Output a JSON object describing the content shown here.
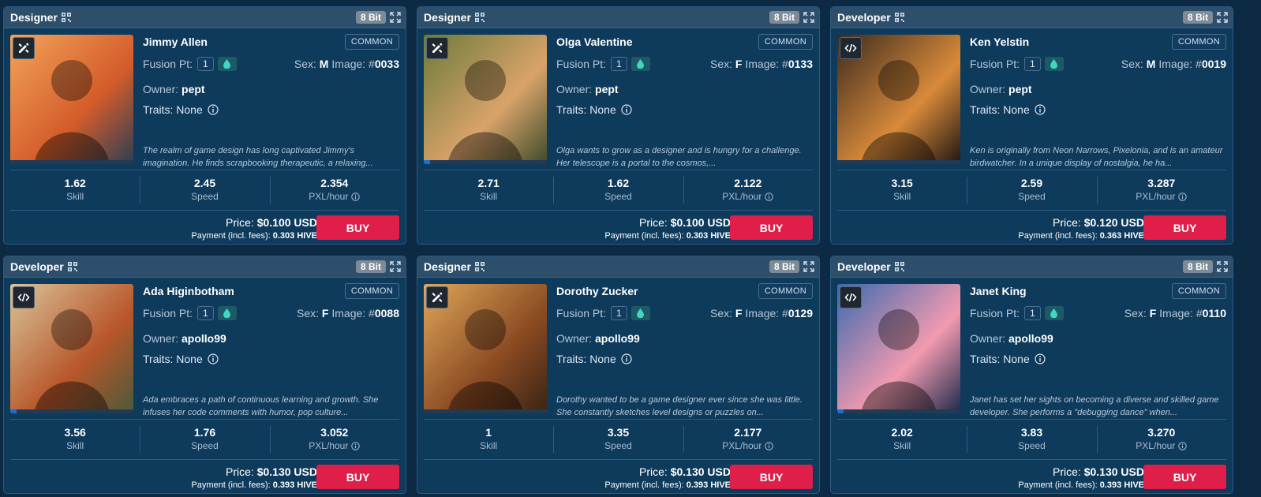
{
  "common_labels": {
    "fusion_label": "Fusion Pt:",
    "sex_label": "Sex:",
    "image_label": "Image: #",
    "owner_label": "Owner:",
    "traits_label": "Traits: None",
    "skill_label": "Skill",
    "speed_label": "Speed",
    "pxl_label": "PXL/hour",
    "price_label": "Price:",
    "payment_label": "Payment (incl. fees):",
    "buy_label": "BUY",
    "bit_label": "8 Bit",
    "rarity": "COMMON"
  },
  "cards": [
    {
      "role": "Designer",
      "role_icon": "design-tools-icon",
      "name": "Jimmy Allen",
      "fusion": "1",
      "sex": "M",
      "image": "0033",
      "owner": "pept",
      "desc": "The realm of game design has long captivated Jimmy's imagination. He finds scrapbooking therapeutic, a relaxing...",
      "skill": "1.62",
      "speed": "2.45",
      "pxl": "2.354",
      "price": "$0.100 USD",
      "payment": "0.303 HIVE",
      "progress": 0,
      "palette": [
        "#f2a45a",
        "#d45c2a",
        "#2b3e55"
      ]
    },
    {
      "role": "Designer",
      "role_icon": "design-tools-icon",
      "name": "Olga Valentine",
      "fusion": "1",
      "sex": "F",
      "image": "0133",
      "owner": "pept",
      "desc": "Olga wants to grow as a designer and is hungry for a challenge. Her telescope is a portal to the cosmos,...",
      "skill": "2.71",
      "speed": "1.62",
      "pxl": "2.122",
      "price": "$0.100 USD",
      "payment": "0.303 HIVE",
      "progress": 0.05,
      "palette": [
        "#6b7a3a",
        "#d9a36a",
        "#3c4a2a"
      ]
    },
    {
      "role": "Developer",
      "role_icon": "code-icon",
      "name": "Ken Yelstin",
      "fusion": "1",
      "sex": "M",
      "image": "0019",
      "owner": "pept",
      "desc": "Ken is originally from Neon Narrows, Pixelonia, and is an amateur birdwatcher. In a unique display of nostalgia, he ha...",
      "skill": "3.15",
      "speed": "2.59",
      "pxl": "3.287",
      "price": "$0.120 USD",
      "payment": "0.363 HIVE",
      "progress": 0,
      "palette": [
        "#3a2a1e",
        "#d98a3a",
        "#1e1612"
      ]
    },
    {
      "role": "Developer",
      "role_icon": "code-icon",
      "name": "Ada Higinbotham",
      "fusion": "1",
      "sex": "F",
      "image": "0088",
      "owner": "apollo99",
      "desc": "Ada embraces a path of continuous learning and growth. She infuses her code comments with humor, pop culture...",
      "skill": "3.56",
      "speed": "1.76",
      "pxl": "3.052",
      "price": "$0.130 USD",
      "payment": "0.393 HIVE",
      "progress": 0.05,
      "palette": [
        "#d9c59a",
        "#b8562a",
        "#4a5a3a"
      ]
    },
    {
      "role": "Designer",
      "role_icon": "design-tools-icon",
      "name": "Dorothy Zucker",
      "fusion": "1",
      "sex": "F",
      "image": "0129",
      "owner": "apollo99",
      "desc": "Dorothy wanted to be a game designer ever since she was little. She constantly sketches level designs or puzzles on...",
      "skill": "1",
      "speed": "3.35",
      "pxl": "2.177",
      "price": "$0.130 USD",
      "payment": "0.393 HIVE",
      "progress": 0,
      "palette": [
        "#e0a65a",
        "#8a4a22",
        "#3a2416"
      ]
    },
    {
      "role": "Developer",
      "role_icon": "code-icon",
      "name": "Janet King",
      "fusion": "1",
      "sex": "F",
      "image": "0110",
      "owner": "apollo99",
      "desc": "Janet has set her sights on becoming a diverse and skilled game developer. She performs a \"debugging dance\" when...",
      "skill": "2.02",
      "speed": "3.83",
      "pxl": "3.270",
      "price": "$0.130 USD",
      "payment": "0.393 HIVE",
      "progress": 0.05,
      "palette": [
        "#3a6ab0",
        "#f29ab0",
        "#1a2a4a"
      ]
    }
  ]
}
